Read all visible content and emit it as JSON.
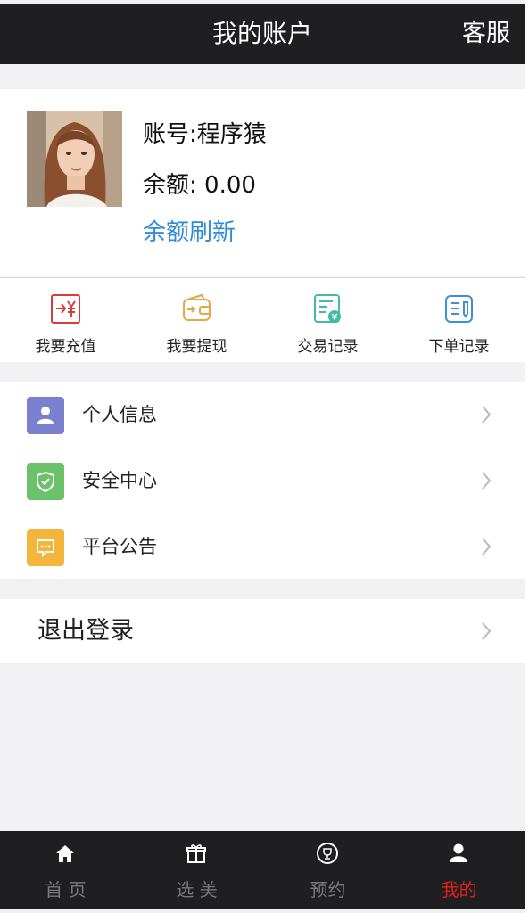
{
  "header": {
    "title": "我的账户",
    "service": "客服"
  },
  "profile": {
    "account_label": "账号:",
    "account_name": "程序猿",
    "balance_label": "余额:",
    "balance_value": "0.00",
    "refresh_label": "余额刷新"
  },
  "actions": [
    {
      "label": "我要充值",
      "icon": "recharge-icon",
      "color": "#d93a3a"
    },
    {
      "label": "我要提现",
      "icon": "wallet-icon",
      "color": "#e3a84a"
    },
    {
      "label": "交易记录",
      "icon": "transaction-icon",
      "color": "#45b9a8"
    },
    {
      "label": "下单记录",
      "icon": "order-icon",
      "color": "#3f8fd8"
    }
  ],
  "menu": [
    {
      "label": "个人信息",
      "icon": "person-icon",
      "color": "#7a7fcf"
    },
    {
      "label": "安全中心",
      "icon": "shield-icon",
      "color": "#6cc26b"
    },
    {
      "label": "平台公告",
      "icon": "message-icon",
      "color": "#f5b43c"
    }
  ],
  "logout": {
    "label": "退出登录"
  },
  "tabbar": {
    "active_color": "#e02020",
    "items": [
      {
        "label": "首 页",
        "icon": "home-icon"
      },
      {
        "label": "选 美",
        "icon": "gift-icon"
      },
      {
        "label": "预约",
        "icon": "trophy-icon"
      },
      {
        "label": "我的",
        "icon": "user-icon"
      }
    ]
  }
}
